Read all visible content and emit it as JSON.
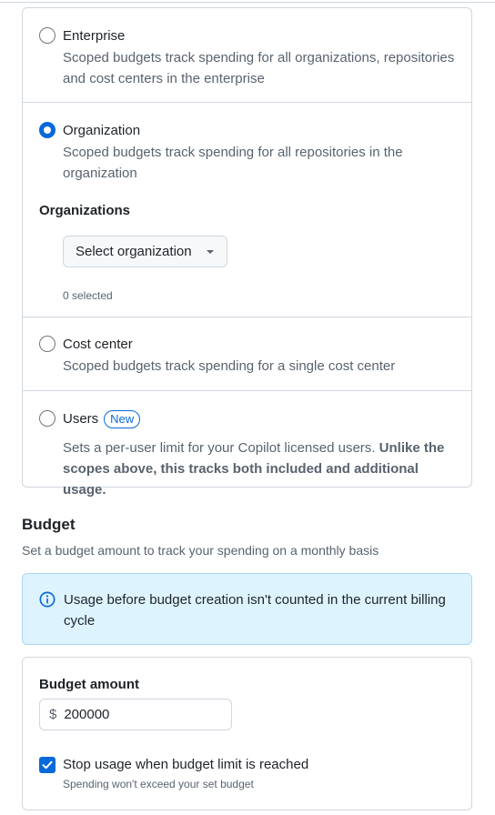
{
  "scopes": {
    "enterprise": {
      "title": "Enterprise",
      "description": "Scoped budgets track spending for all organizations, repositories and cost centers in the enterprise",
      "selected": false
    },
    "organization": {
      "title": "Organization",
      "description": "Scoped budgets track spending for all repositories in the organization",
      "selected": true,
      "organizations_label": "Organizations",
      "select_label": "Select organization",
      "selected_count": "0 selected"
    },
    "cost_center": {
      "title": "Cost center",
      "description": "Scoped budgets track spending for a single cost center",
      "selected": false
    },
    "users": {
      "title": "Users",
      "badge": "New",
      "description": "Sets a per-user limit for your Copilot licensed users.",
      "description_bold": "Unlike the scopes above, this tracks both included and additional usage.",
      "selected": false
    }
  },
  "budget": {
    "title": "Budget",
    "description": "Set a budget amount to track your spending on a monthly basis",
    "info": "Usage before budget creation isn't counted in the current billing cycle",
    "amount_label": "Budget amount",
    "currency": "$",
    "amount": "200000",
    "stop_usage_label": "Stop usage when budget limit is reached",
    "stop_usage_checked": true,
    "stop_usage_note": "Spending won't exceed your set budget"
  },
  "icons": {
    "info": "info-icon",
    "caret": "triangle-down-icon",
    "check": "check-icon"
  },
  "colors": {
    "accent": "#0969da",
    "info_bg": "#ddf4ff",
    "border": "#d0d7de"
  }
}
